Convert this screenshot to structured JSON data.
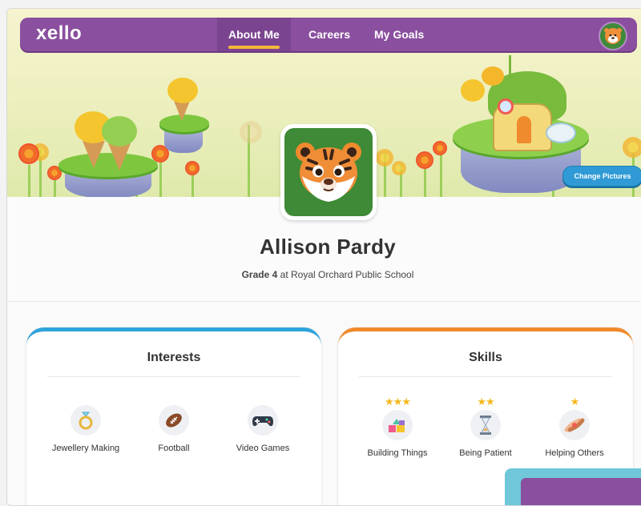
{
  "brand": {
    "logo": "xello"
  },
  "nav": {
    "tabs": [
      {
        "label": "About Me",
        "active": true
      },
      {
        "label": "Careers",
        "active": false
      },
      {
        "label": "My Goals",
        "active": false
      }
    ],
    "avatar_icon": "tiger-face-icon"
  },
  "hero": {
    "change_pictures_label": "Change Pictures"
  },
  "profile": {
    "avatar_icon": "tiger-face-icon",
    "name": "Allison Pardy",
    "grade_label": "Grade 4",
    "grade_suffix": "at Royal Orchard Public School"
  },
  "interests": {
    "title": "Interests",
    "accent": "#2ea3db",
    "items": [
      {
        "label": "Jewellery Making",
        "icon": "ring-icon"
      },
      {
        "label": "Football",
        "icon": "football-icon"
      },
      {
        "label": "Video Games",
        "icon": "game-controller-icon"
      }
    ]
  },
  "skills": {
    "title": "Skills",
    "accent": "#f08a2c",
    "items": [
      {
        "label": "Building Things",
        "icon": "blocks-icon",
        "stars": 3
      },
      {
        "label": "Being Patient",
        "icon": "hourglass-icon",
        "stars": 2
      },
      {
        "label": "Helping Others",
        "icon": "helping-hands-icon",
        "stars": 1
      }
    ]
  },
  "colors": {
    "nav": "#8a4f9f",
    "avatar_bg": "#3e8a36",
    "button": "#2f9ad5"
  }
}
